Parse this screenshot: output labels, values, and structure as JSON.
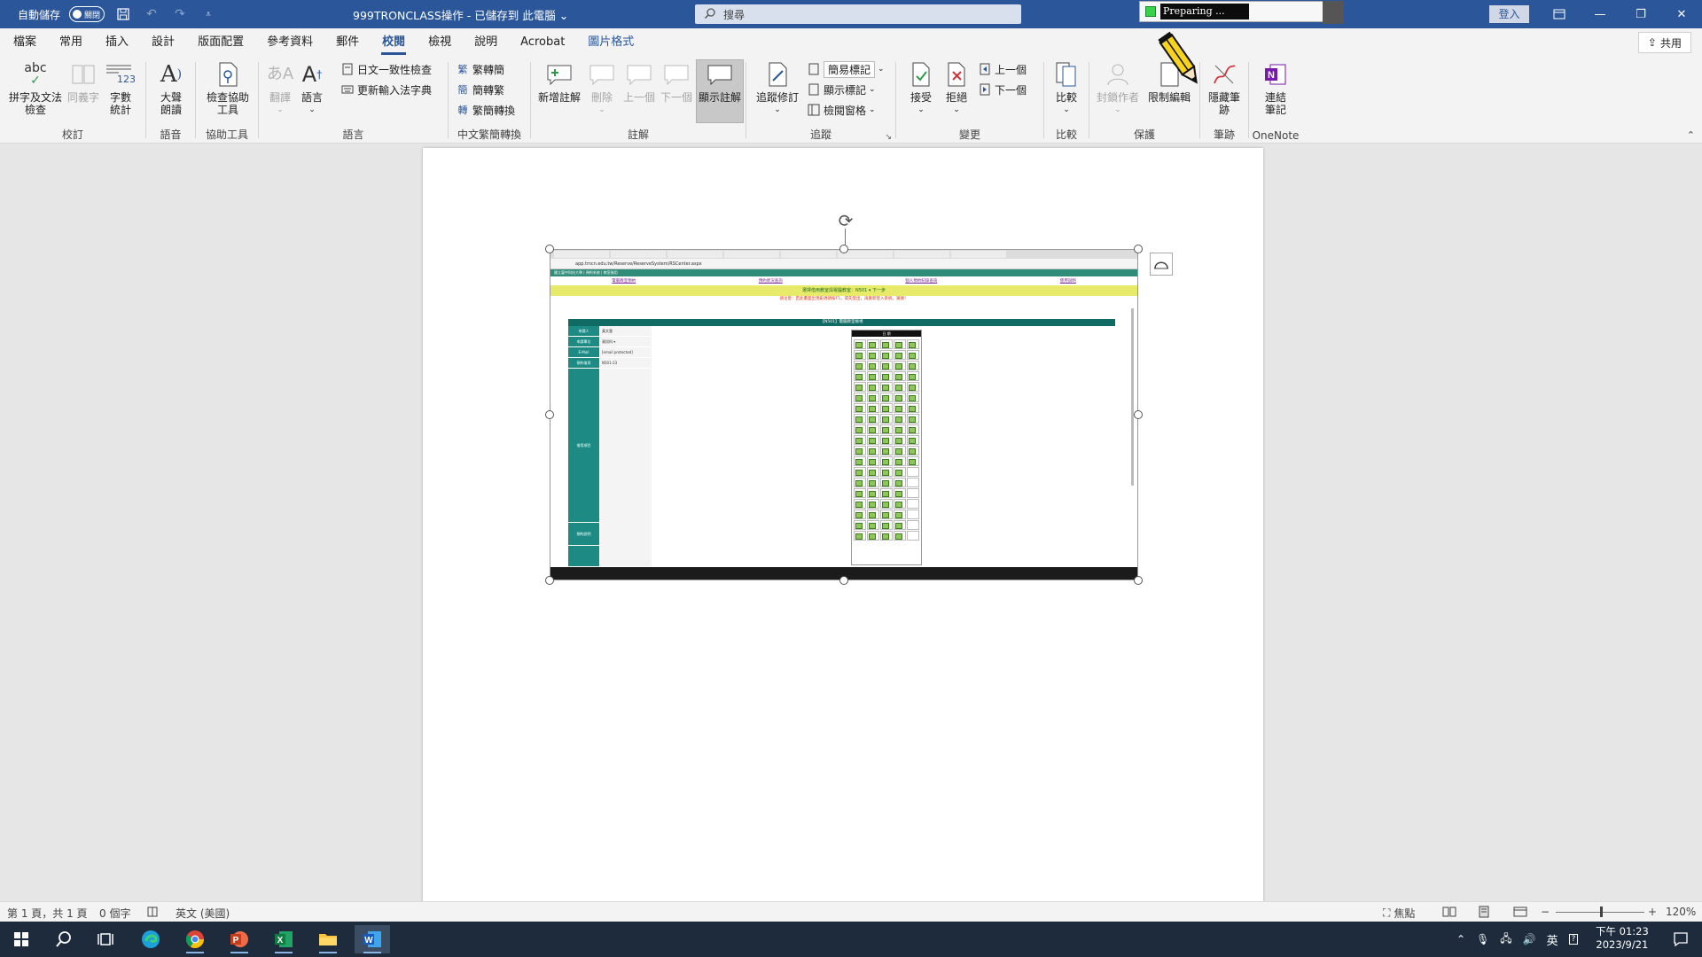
{
  "titlebar": {
    "autosave_label": "自動儲存",
    "autosave_state": "關閉",
    "doc_title": "999TRONCLASS操作 - 已儲存到 此電腦",
    "doc_title_caret": "⌄",
    "search_placeholder": "搜尋",
    "preparing_text": "Preparing ...",
    "signin_label": "登入"
  },
  "menu": {
    "tabs": [
      "檔案",
      "常用",
      "插入",
      "設計",
      "版面配置",
      "參考資料",
      "郵件",
      "校閱",
      "檢視",
      "說明",
      "Acrobat",
      "圖片格式"
    ],
    "active_tab": "校閱",
    "share_label": "共用"
  },
  "ribbon": {
    "proofing": {
      "label": "校訂",
      "spelling": "拼字及文法\n檢查",
      "thesaurus": "同義字",
      "wordcount": "字數\n統計",
      "abc": "abc",
      "count_digits": "123"
    },
    "speech": {
      "label": "語音",
      "read_aloud": "大聲\n朗讀"
    },
    "accessibility": {
      "label": "協助工具",
      "check": "檢查協助\n工具"
    },
    "language": {
      "label": "語言",
      "translate": "翻譯",
      "language": "語言",
      "jp_check": "日文一致性檢查",
      "ime_update": "更新輸入法字典"
    },
    "chinese_conv": {
      "label": "中文繁簡轉換",
      "to_simplified": "繁轉簡",
      "to_traditional": "簡轉繁",
      "convert": "繁簡轉換"
    },
    "comments": {
      "label": "註解",
      "new": "新增註解",
      "delete": "刪除",
      "prev": "上一個",
      "next": "下一個",
      "show": "顯示註解"
    },
    "tracking": {
      "label": "追蹤",
      "track": "追蹤修訂",
      "simple_markup": "簡易標記",
      "show_markup": "顯示標記",
      "review_pane": "檢閱窗格"
    },
    "changes": {
      "label": "變更",
      "accept": "接受",
      "reject": "拒絕",
      "prev": "上一個",
      "next": "下一個"
    },
    "compare": {
      "label": "比較",
      "compare": "比較"
    },
    "protect": {
      "label": "保護",
      "block_authors": "封鎖作者",
      "restrict": "限制編輯"
    },
    "ink": {
      "label": "筆跡",
      "hide_ink": "隱藏筆\n跡"
    },
    "onenote": {
      "label": "OneNote",
      "linked_notes": "連結\n筆記"
    }
  },
  "embedded": {
    "url": "app.tmcn.edu.tw/Reserve/ReserveSystem/RSCenter.aspx",
    "header": "國立臺中科技大學 | 預約系統 | 教室借用",
    "nav": [
      "電腦教室預約",
      "預約狀況查詢",
      "個人預約紀錄查詢",
      "使用說明"
    ],
    "yellow_bar": "選擇借用教室與電腦教室：N501 ▾ 下一步",
    "note": "請注意：若此畫面出現亂碼請按F5，或先登出，再重新登入系統，謝謝！",
    "title": "【N501】電腦教室檢視",
    "left_labels": [
      "申請人",
      "申請單位",
      "E-Mail",
      "預約借用",
      "借用項目",
      "預約說明"
    ],
    "form_values": [
      "黃文惠",
      "資訊科 ▾",
      "[email protected]",
      "N501-23",
      "",
      ""
    ],
    "cal_header": "日    期"
  },
  "status": {
    "page": "第 1 頁，共 1 頁",
    "words": "0 個字",
    "language": "英文 (美國)",
    "focus": "焦點",
    "zoom": "120%"
  },
  "taskbar": {
    "ime": "英",
    "time": "下午 01:23",
    "date": "2023/9/21"
  },
  "colors": {
    "word_blue": "#2b579a",
    "ribbon_bg": "#f3f3f3",
    "taskbar_bg": "#1d2b3c"
  }
}
